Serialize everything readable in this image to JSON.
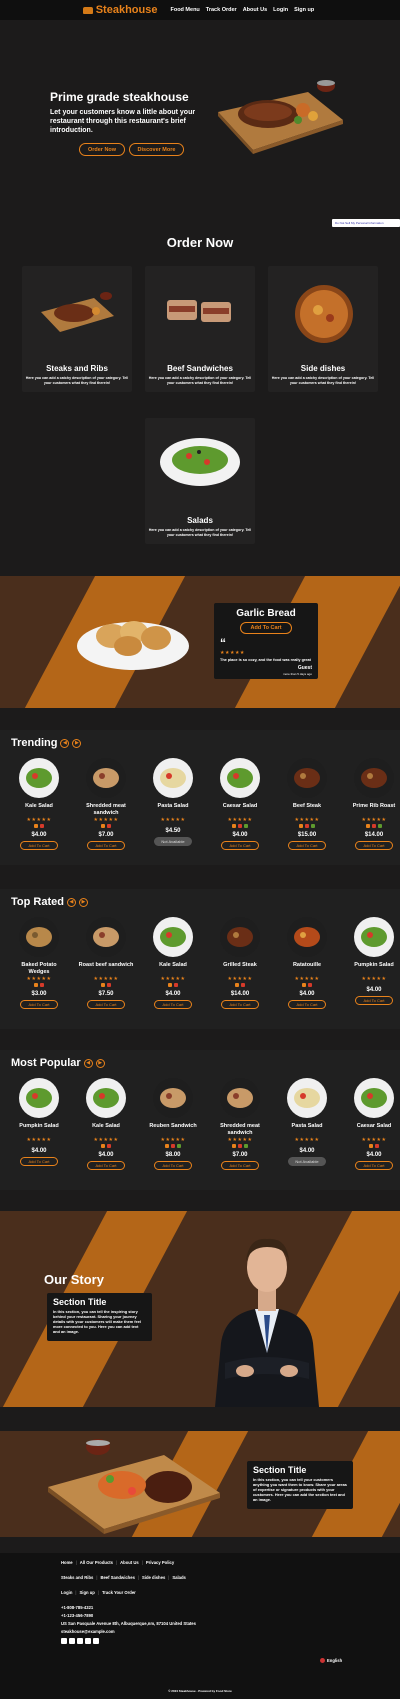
{
  "header": {
    "brand": "Steakhouse",
    "nav": [
      "Food Menu",
      "Track Order",
      "About Us",
      "Login",
      "Sign up"
    ]
  },
  "hero": {
    "title": "Prime grade steakhouse",
    "subtitle": "Let your customers know a little about your restaurant through this restaurant's brief introduction.",
    "order_btn": "Order Now",
    "discover_btn": "Discover More"
  },
  "cookie_banner": "Do Not Sell My Personal Information",
  "order_now": {
    "title": "Order Now",
    "categories": [
      {
        "name": "Steaks and Ribs",
        "desc": "Here you can add a catchy description of your category. Tell your customers what they find therein!"
      },
      {
        "name": "Beef Sandwiches",
        "desc": "Here you can add a catchy description of your category. Tell your customers what they find therein!"
      },
      {
        "name": "Side dishes",
        "desc": "Here you can add a catchy description of your category. Tell your customers what they find therein!"
      },
      {
        "name": "Salads",
        "desc": "Here you can add a catchy description of your category. Tell your customers what they find therein!"
      }
    ]
  },
  "featured": {
    "name": "Garlic Bread",
    "cart_btn": "Add To Cart",
    "quote_mark": "“",
    "stars": "★★★★★",
    "review": "The place is so cozy, and the food was really great",
    "reviewer": "Guest",
    "review_date": "more than 5 days ago"
  },
  "trending": {
    "title": "Trending",
    "items": [
      {
        "name": "Kale Salad",
        "price": "$4.00",
        "cart": "Add To Cart"
      },
      {
        "name": "Shredded meat sandwich",
        "price": "$7.00",
        "cart": "Add To Cart"
      },
      {
        "name": "Pasta Salad",
        "price": "$4.50",
        "cart": "Not Available"
      },
      {
        "name": "Caesar Salad",
        "price": "$4.00",
        "cart": "Add To Cart"
      },
      {
        "name": "Beef Steak",
        "price": "$15.00",
        "cart": "Add To Cart"
      },
      {
        "name": "Prime Rib Roast",
        "price": "$14.00",
        "cart": "Add To Cart"
      }
    ]
  },
  "top_rated": {
    "title": "Top Rated",
    "items": [
      {
        "name": "Baked Potato Wedges",
        "price": "$3.00",
        "cart": "Add To Cart"
      },
      {
        "name": "Roast beef sandwich",
        "price": "$7.50",
        "cart": "Add To Cart"
      },
      {
        "name": "Kale Salad",
        "price": "$4.00",
        "cart": "Add To Cart"
      },
      {
        "name": "Grilled Steak",
        "price": "$14.00",
        "cart": "Add To Cart"
      },
      {
        "name": "Ratatouille",
        "price": "$4.00",
        "cart": "Add To Cart"
      },
      {
        "name": "Pumpkin Salad",
        "price": "$4.00",
        "cart": "Add To Cart"
      }
    ]
  },
  "most_popular": {
    "title": "Most Popular",
    "items": [
      {
        "name": "Pumpkin Salad",
        "price": "$4.00",
        "cart": "Add To Cart"
      },
      {
        "name": "Kale Salad",
        "price": "$4.00",
        "cart": "Add To Cart"
      },
      {
        "name": "Reuben Sandwich",
        "price": "$8.00",
        "cart": "Add To Cart"
      },
      {
        "name": "Shredded meat sandwich",
        "price": "$7.00",
        "cart": "Add To Cart"
      },
      {
        "name": "Pasta Salad",
        "price": "$4.00",
        "cart": "Not Available"
      },
      {
        "name": "Caesar Salad",
        "price": "$4.00",
        "cart": "Add To Cart"
      }
    ]
  },
  "our_story": {
    "title": "Our Story",
    "section_title": "Section Title",
    "body": "In this section, you can tell the inspiring story behind your restaurant. Sharing your journey details with your customers will make them feel more connected to you. Here you can add text and an image."
  },
  "expertise": {
    "section_title": "Section Title",
    "body": "In this section, you can tell your customers anything you want them to know. Share your areas of expertise or signature products with your customers. Here you can add the section text and an image."
  },
  "footer": {
    "row1": [
      "Home",
      "All Our Products",
      "About Us",
      "Privacy Policy"
    ],
    "row2": [
      "Steaks and Ribs",
      "Beef Sandwiches",
      "Side dishes",
      "Salads"
    ],
    "row3": [
      "Login",
      "Sign up",
      "Track Your Order"
    ],
    "phone1": "+1-808-785-4321",
    "phone2": "+1-123-456-7890",
    "address": "US San Pasquale Avenue 8th, Albuquerque,nm, 87104 United States",
    "email": "steakhouse@example.com",
    "language": "English",
    "copyright": "© 2024 Steakhouse - Powered by Food Store"
  },
  "colors": {
    "accent": "#e8821b",
    "band": "#4a2e1c",
    "stripe": "#b46618",
    "bg": "#1c1b1b"
  }
}
